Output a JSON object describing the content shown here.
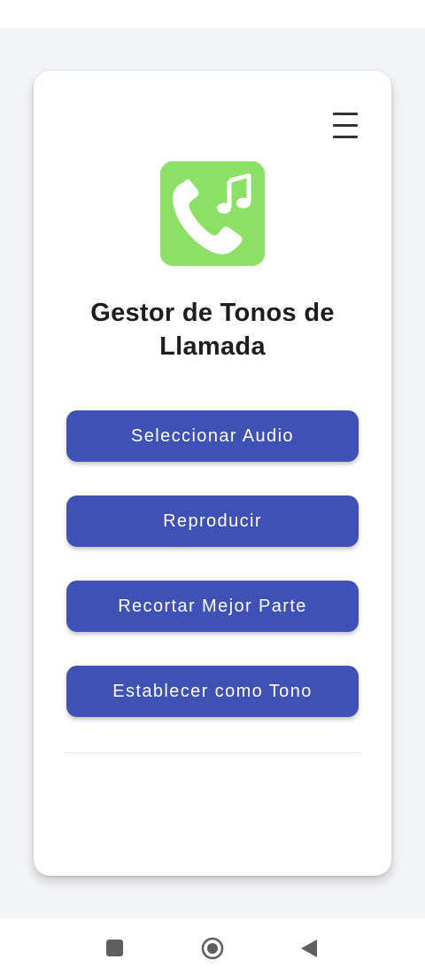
{
  "app": {
    "title": "Gestor de Tonos de Llamada"
  },
  "buttons": {
    "select_audio": "Seleccionar Audio",
    "play": "Reproducir",
    "trim": "Recortar Mejor Parte",
    "set_ringtone": "Establecer como Tono"
  },
  "icons": {
    "menu": "hamburger-menu-icon",
    "logo": "phone-with-music-note-icon",
    "nav_recents": "square-icon",
    "nav_home": "circle-icon",
    "nav_back": "triangle-back-icon"
  },
  "colors": {
    "primary": "#3f51b5",
    "logo_background": "#8ce065",
    "card_background": "#ffffff",
    "page_background": "#f3f4f6",
    "title_text": "#1c1d1f"
  }
}
